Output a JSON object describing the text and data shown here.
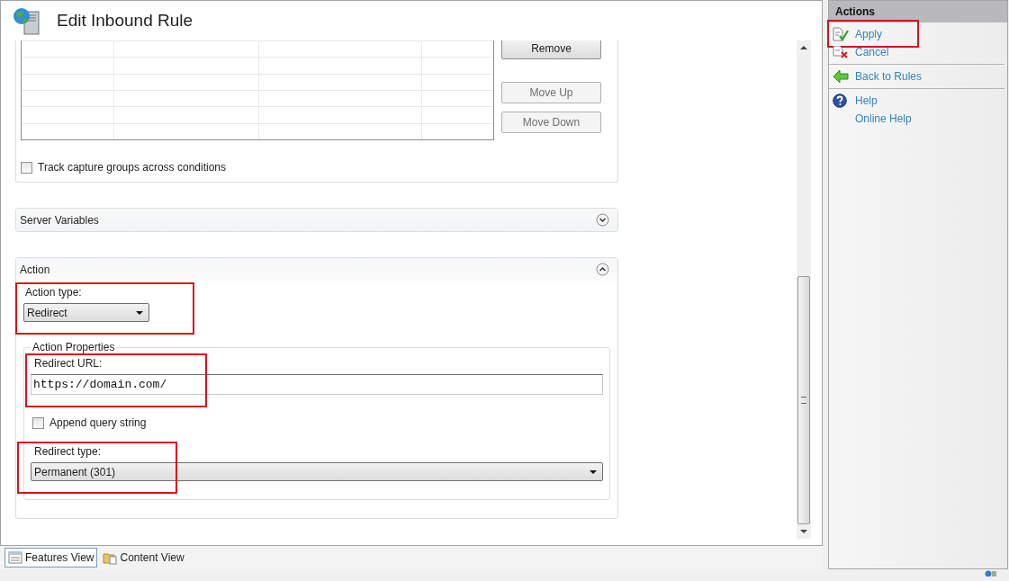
{
  "window": {
    "title": "Edit Inbound Rule"
  },
  "condition_buttons": [
    {
      "label": "Remove",
      "disabled": false
    },
    {
      "label": "Move Up",
      "disabled": true
    },
    {
      "label": "Move Down",
      "disabled": true
    }
  ],
  "track_capture_groups": {
    "label": "Track capture groups across conditions",
    "checked": false
  },
  "sections": [
    {
      "title": "Server Variables",
      "expanded": false
    },
    {
      "title": "Action",
      "expanded": true
    }
  ],
  "action": {
    "action_type": {
      "label": "Action type:",
      "value": "Redirect",
      "highlighted": true
    },
    "properties_title": "Action Properties",
    "redirect_url": {
      "label": "Redirect URL:",
      "value": "https://domain.com/",
      "highlighted": true
    },
    "append_query_string": {
      "label": "Append query string",
      "checked": false
    },
    "redirect_type": {
      "label": "Redirect type:",
      "value": "Permanent (301)",
      "highlighted": true
    }
  },
  "actions_panel": {
    "title": "Actions",
    "groups": [
      [
        {
          "label": "Apply",
          "kind": "apply",
          "highlighted": true
        },
        {
          "label": "Cancel",
          "kind": "cancel",
          "highlighted": false
        }
      ],
      [
        {
          "label": "Back to Rules",
          "kind": "back",
          "highlighted": false
        }
      ],
      [
        {
          "label": "Help",
          "kind": "help",
          "highlighted": false
        },
        {
          "label": "Online Help",
          "kind": "plain",
          "highlighted": false
        }
      ]
    ]
  },
  "view_tabs": [
    {
      "label": "Features View",
      "selected": true
    },
    {
      "label": "Content View",
      "selected": false
    }
  ]
}
